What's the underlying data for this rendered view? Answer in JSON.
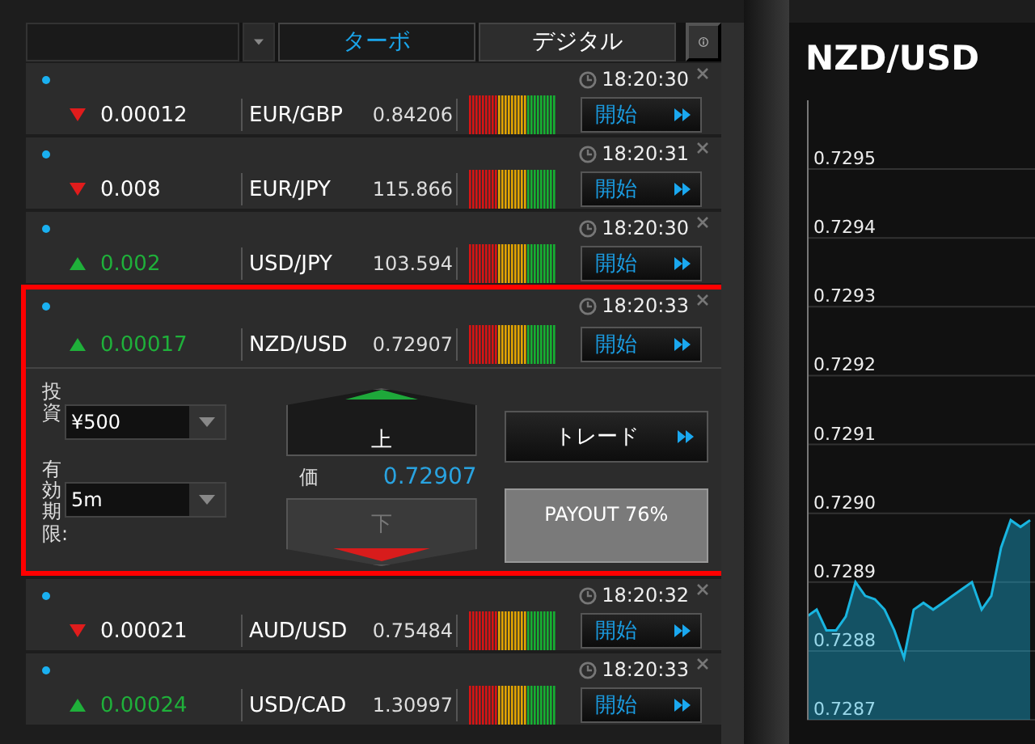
{
  "header": {
    "tabs": [
      {
        "label": "ターボ",
        "selected": true
      },
      {
        "label": "デジタル",
        "selected": false
      }
    ]
  },
  "rows": [
    {
      "rising": false,
      "change": "0.00012",
      "pair": "EUR/GBP",
      "price": "0.84206",
      "time": "18:20:30",
      "button": "開始",
      "expanded": false
    },
    {
      "rising": false,
      "change": "0.008",
      "pair": "EUR/JPY",
      "price": "115.866",
      "time": "18:20:31",
      "button": "開始",
      "expanded": false
    },
    {
      "rising": true,
      "change": "0.002",
      "pair": "USD/JPY",
      "price": "103.594",
      "time": "18:20:30",
      "button": "開始",
      "expanded": false
    },
    {
      "rising": true,
      "change": "0.00017",
      "pair": "NZD/USD",
      "price": "0.72907",
      "time": "18:20:33",
      "button": "開始",
      "expanded": true,
      "panel": {
        "investment_label": "投資",
        "investment": "¥500",
        "expiry_label": "有効期限:",
        "expiry": "5m",
        "up": {
          "label": "上",
          "disabled": false
        },
        "down": {
          "label": "下",
          "disabled": true
        },
        "price_label": "価",
        "price": "0.72907",
        "trade_button": "トレード",
        "payout": "PAYOUT 76%"
      }
    },
    {
      "rising": false,
      "change": "0.00021",
      "pair": "AUD/USD",
      "price": "0.75484",
      "time": "18:20:32",
      "button": "開始",
      "expanded": false
    },
    {
      "rising": true,
      "change": "0.00024",
      "pair": "USD/CAD",
      "price": "1.30997",
      "time": "18:20:33",
      "button": "開始",
      "expanded": false
    }
  ],
  "chart": {
    "title": "NZD/USD",
    "chart_data": {
      "type": "area",
      "categories": [
        null,
        null,
        null,
        null,
        null,
        null,
        null,
        null,
        null,
        null,
        null,
        null,
        null,
        null,
        null,
        null,
        null,
        null,
        null,
        null,
        null,
        null,
        null,
        null
      ],
      "series": [
        {
          "color": "#19b5e0",
          "values": [
            0.72885,
            0.72886,
            0.72883,
            0.72883,
            0.72885,
            0.7289,
            0.72888,
            0.728875,
            0.72886,
            0.72883,
            0.72879,
            0.72886,
            0.72887,
            0.72886,
            0.72887,
            0.72888,
            0.72889,
            0.7289,
            0.72886,
            0.72888,
            0.72895,
            0.72899,
            0.72898,
            0.72899
          ]
        }
      ],
      "ylim": [
        0.7287,
        0.7296
      ],
      "grid": true,
      "yticks": [
        {
          "value": 0.7295,
          "label": "0.7295"
        },
        {
          "value": 0.7294,
          "label": "0.7294"
        },
        {
          "value": 0.7293,
          "label": "0.7293"
        },
        {
          "value": 0.7292,
          "label": "0.7292"
        },
        {
          "value": 0.7291,
          "label": "0.7291"
        },
        {
          "value": 0.729,
          "label": "0.7290"
        },
        {
          "value": 0.7289,
          "label": "0.7289"
        },
        {
          "value": 0.7288,
          "label": "0.7288"
        },
        {
          "value": 0.7287,
          "label": "0.7287"
        }
      ]
    }
  }
}
